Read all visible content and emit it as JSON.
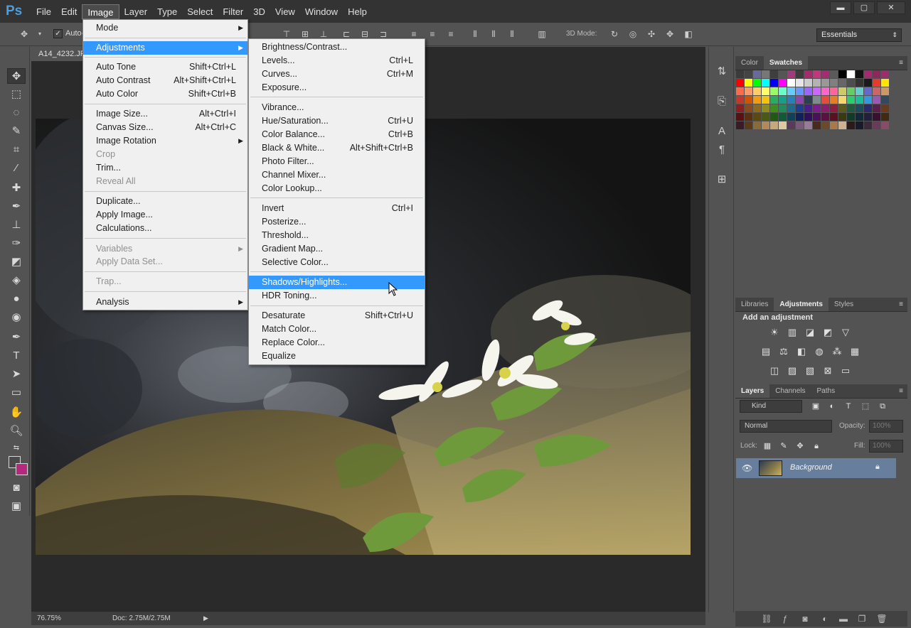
{
  "app": {
    "logo": "Ps",
    "menu": [
      "File",
      "Edit",
      "Image",
      "Layer",
      "Type",
      "Select",
      "Filter",
      "3D",
      "View",
      "Window",
      "Help"
    ],
    "window_controls": [
      "▬",
      "▢",
      "✕"
    ]
  },
  "options_bar": {
    "auto_label": "Auto-",
    "mode_3d_label": "3D Mode:",
    "workspace": "Essentials"
  },
  "document": {
    "tab_title": "A14_4232.JP",
    "zoom": "76.75%",
    "doc_size": "Doc: 2.75M/2.75M"
  },
  "image_menu": {
    "items": [
      {
        "label": "Mode",
        "shortcut": "",
        "submenu": true,
        "disabled": false
      },
      {
        "label": "Adjustments",
        "shortcut": "",
        "submenu": true,
        "disabled": false,
        "highlighted": true
      },
      {
        "label": "Auto Tone",
        "shortcut": "Shift+Ctrl+L",
        "disabled": false
      },
      {
        "label": "Auto Contrast",
        "shortcut": "Alt+Shift+Ctrl+L",
        "disabled": false
      },
      {
        "label": "Auto Color",
        "shortcut": "Shift+Ctrl+B",
        "disabled": false
      },
      {
        "label": "Image Size...",
        "shortcut": "Alt+Ctrl+I",
        "disabled": false
      },
      {
        "label": "Canvas Size...",
        "shortcut": "Alt+Ctrl+C",
        "disabled": false
      },
      {
        "label": "Image Rotation",
        "shortcut": "",
        "submenu": true,
        "disabled": false
      },
      {
        "label": "Crop",
        "shortcut": "",
        "disabled": true
      },
      {
        "label": "Trim...",
        "shortcut": "",
        "disabled": false
      },
      {
        "label": "Reveal All",
        "shortcut": "",
        "disabled": true
      },
      {
        "label": "Duplicate...",
        "shortcut": "",
        "disabled": false
      },
      {
        "label": "Apply Image...",
        "shortcut": "",
        "disabled": false
      },
      {
        "label": "Calculations...",
        "shortcut": "",
        "disabled": false
      },
      {
        "label": "Variables",
        "shortcut": "",
        "submenu": true,
        "disabled": true
      },
      {
        "label": "Apply Data Set...",
        "shortcut": "",
        "disabled": true
      },
      {
        "label": "Trap...",
        "shortcut": "",
        "disabled": true
      },
      {
        "label": "Analysis",
        "shortcut": "",
        "submenu": true,
        "disabled": false
      }
    ]
  },
  "adjustments_menu": {
    "items": [
      {
        "label": "Brightness/Contrast...",
        "shortcut": ""
      },
      {
        "label": "Levels...",
        "shortcut": "Ctrl+L"
      },
      {
        "label": "Curves...",
        "shortcut": "Ctrl+M"
      },
      {
        "label": "Exposure...",
        "shortcut": ""
      },
      {
        "label": "Vibrance...",
        "shortcut": ""
      },
      {
        "label": "Hue/Saturation...",
        "shortcut": "Ctrl+U"
      },
      {
        "label": "Color Balance...",
        "shortcut": "Ctrl+B"
      },
      {
        "label": "Black & White...",
        "shortcut": "Alt+Shift+Ctrl+B"
      },
      {
        "label": "Photo Filter...",
        "shortcut": ""
      },
      {
        "label": "Channel Mixer...",
        "shortcut": ""
      },
      {
        "label": "Color Lookup...",
        "shortcut": ""
      },
      {
        "label": "Invert",
        "shortcut": "Ctrl+I"
      },
      {
        "label": "Posterize...",
        "shortcut": ""
      },
      {
        "label": "Threshold...",
        "shortcut": ""
      },
      {
        "label": "Gradient Map...",
        "shortcut": ""
      },
      {
        "label": "Selective Color...",
        "shortcut": ""
      },
      {
        "label": "Shadows/Highlights...",
        "shortcut": "",
        "highlighted": true
      },
      {
        "label": "HDR Toning...",
        "shortcut": ""
      },
      {
        "label": "Desaturate",
        "shortcut": "Shift+Ctrl+U"
      },
      {
        "label": "Match Color...",
        "shortcut": ""
      },
      {
        "label": "Replace Color...",
        "shortcut": ""
      },
      {
        "label": "Equalize",
        "shortcut": ""
      }
    ]
  },
  "panels": {
    "color_tabs": [
      "Color",
      "Swatches"
    ],
    "adjust_tabs": [
      "Libraries",
      "Adjustments",
      "Styles"
    ],
    "adjust_title": "Add an adjustment",
    "layers_tabs": [
      "Layers",
      "Channels",
      "Paths"
    ],
    "layer_filter": "Kind",
    "blend_mode": "Normal",
    "opacity_label": "Opacity:",
    "opacity_value": "100%",
    "lock_label": "Lock:",
    "fill_label": "Fill:",
    "fill_value": "100%",
    "layer_name": "Background"
  },
  "colors": {
    "accent_highlight": "#3399ff",
    "foreground_swatch": "#4a4a4a",
    "background_swatch": "#b4297e",
    "layer_selected": "#677e9c"
  },
  "swatches": [
    "#3b3b3b",
    "#444444",
    "#6a6a9a",
    "#777777",
    "#3e3e3e",
    "#555555",
    "#a03a7a",
    "#3c3c3c",
    "#a32b6e",
    "#c2367c",
    "#a52d6f",
    "#5a5a5a",
    "#000000",
    "#ffffff",
    "#111111",
    "#a12b6b",
    "#8a2a5c",
    "#9a2e6a",
    "#ff0000",
    "#ffff00",
    "#00ff00",
    "#00ffff",
    "#0000ff",
    "#ff00ff",
    "#ffffff",
    "#e6e6e6",
    "#cccccc",
    "#b3b3b3",
    "#999999",
    "#808080",
    "#666666",
    "#4d4d4d",
    "#333333",
    "#1a1a1a",
    "#e63a2a",
    "#ffe600",
    "#ff6a4a",
    "#ff9966",
    "#ffcc66",
    "#ffff66",
    "#99ff66",
    "#66ffcc",
    "#66ccff",
    "#6699ff",
    "#9966ff",
    "#cc66ff",
    "#ff66cc",
    "#ff6699",
    "#cccc66",
    "#66cc66",
    "#66cccc",
    "#6666cc",
    "#cc6666",
    "#cc9966",
    "#c0392b",
    "#d35400",
    "#f39c12",
    "#f1c40f",
    "#27ae60",
    "#16a085",
    "#2980b9",
    "#8e44ad",
    "#2c3e50",
    "#7f8c8d",
    "#e74c3c",
    "#e67e22",
    "#f5d76e",
    "#2ecc71",
    "#1abc9c",
    "#3498db",
    "#9b59b6",
    "#34495e",
    "#8c1f1f",
    "#8c4a1f",
    "#8c6a1f",
    "#8c8c1f",
    "#3f8c1f",
    "#1f8c5a",
    "#1f6a8c",
    "#1f3f8c",
    "#4a1f8c",
    "#7a1f8c",
    "#8c1f6a",
    "#8c1f3f",
    "#5a5a1f",
    "#1f5a3f",
    "#1f4a5a",
    "#2a2a6a",
    "#5a1f4a",
    "#6a3a1f",
    "#5a1010",
    "#5a3010",
    "#5a4a10",
    "#4a5a10",
    "#205a10",
    "#105a3a",
    "#10405a",
    "#10205a",
    "#30105a",
    "#4a105a",
    "#5a1040",
    "#5a1020",
    "#3a3a10",
    "#103a2a",
    "#102a3a",
    "#20203a",
    "#3a1030",
    "#402a10",
    "#3a1a2a",
    "#5a3a1a",
    "#8a6a3a",
    "#b08a5a",
    "#c8a878",
    "#e0c8a0",
    "#5a3a5a",
    "#7a5a7a",
    "#9a7a9a",
    "#4a2a1a",
    "#6a4a2a",
    "#a87a4a",
    "#d0b090",
    "#2a1a1a",
    "#1a1a2a",
    "#3a2a3a",
    "#6a3a5a",
    "#8a4a6a"
  ]
}
